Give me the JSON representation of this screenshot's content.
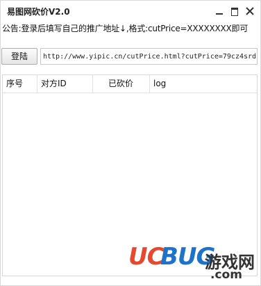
{
  "window": {
    "title": "易图网砍价V2.0"
  },
  "notice": "公告:登录后填写自己的推广地址↓,格式:cutPrice=XXXXXXXX即可",
  "toolbar": {
    "login_label": "登陆",
    "url_value": "http://www.yipic.cn/cutPrice.html?cutPrice=79cz4srd"
  },
  "table": {
    "columns": [
      "序号",
      "对方ID",
      "已砍价",
      "log"
    ],
    "rows": []
  },
  "watermark": {
    "uc": "UC",
    "bug": "BUG",
    "cn": "游戏网",
    "com": ".com"
  }
}
